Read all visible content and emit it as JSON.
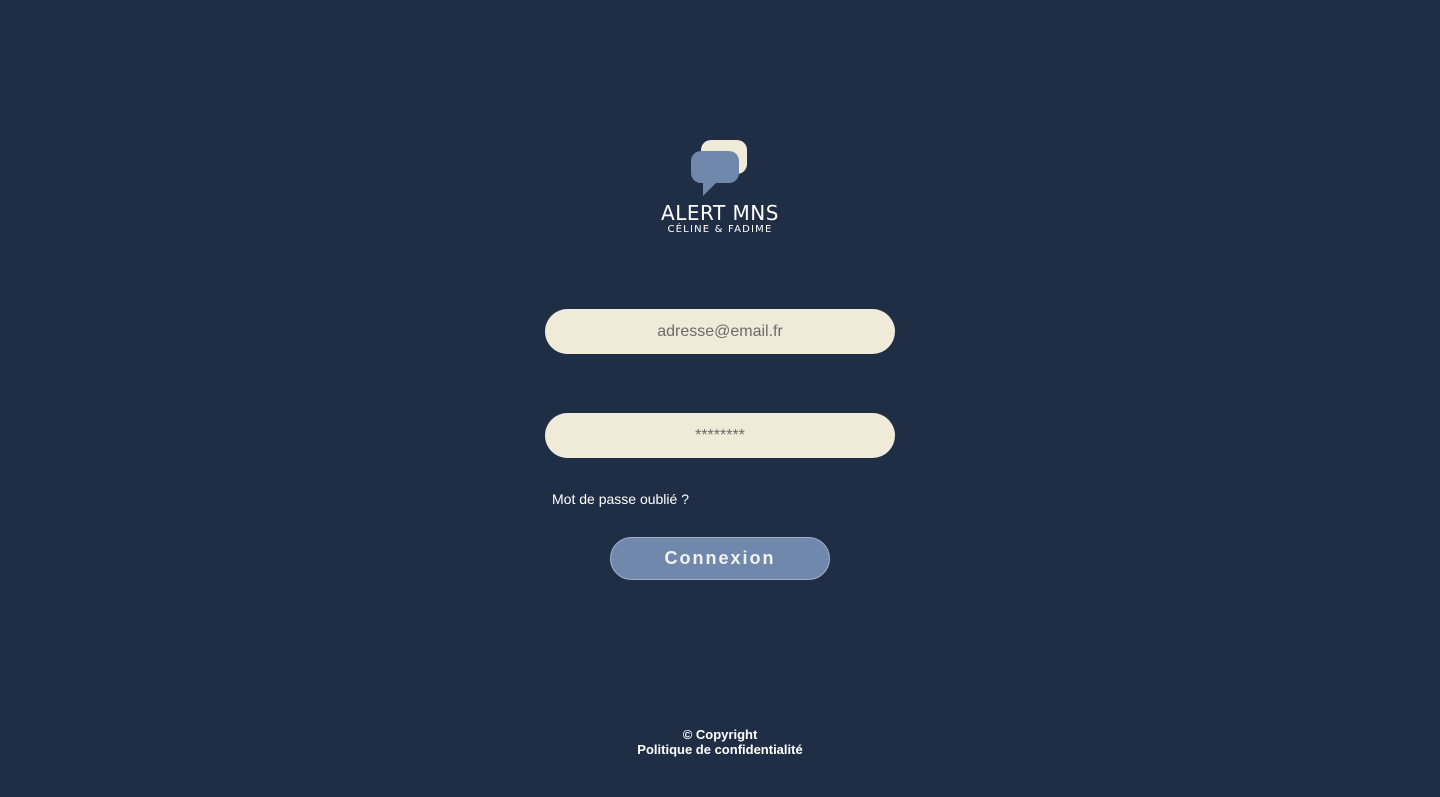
{
  "logo": {
    "title": "ALERT MNS",
    "subtitle": "CÉLINE & FADIME",
    "icon": "chat-bubbles-icon"
  },
  "login_form": {
    "email_placeholder": "adresse@email.fr",
    "password_placeholder": "********",
    "forgot_password_label": "Mot de passe oublié ?",
    "submit_label": "Connexion"
  },
  "footer": {
    "copyright": "© Copyright",
    "privacy_link": "Politique de confidentialité"
  },
  "colors": {
    "background": "#1f2d45",
    "input_background": "#f0ead9",
    "button_background": "#7088ab",
    "logo_bubble_front": "#7088ab",
    "logo_bubble_back": "#f0ead9"
  }
}
